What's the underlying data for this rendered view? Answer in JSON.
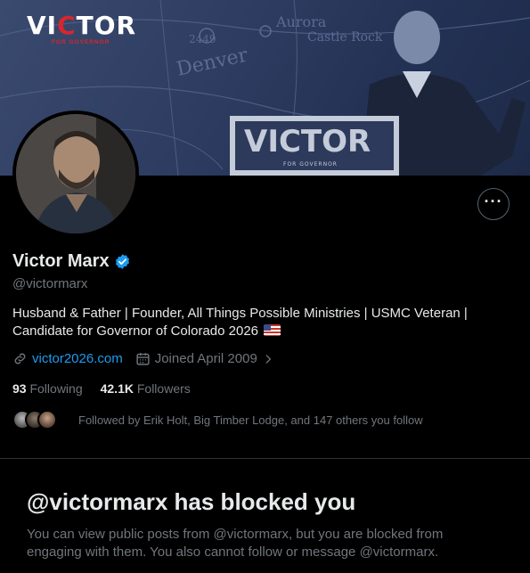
{
  "banner": {
    "brand_title_pre": "VI",
    "brand_title_o": "C",
    "brand_title_post": "TOR",
    "brand_subtitle": "FOR GOVERNOR",
    "map_labels": [
      "Aurora",
      "Castle Rock",
      "Denver",
      "2449"
    ],
    "podium_text": "VICTOR",
    "podium_sub": "FOR GOVERNOR"
  },
  "profile": {
    "name": "Victor Marx",
    "handle": "@victormarx",
    "bio_line1": "Husband & Father | Founder, All Things Possible Ministries | USMC Veteran |",
    "bio_line2": "Candidate for Governor of Colorado 2026",
    "website": "victor2026.com",
    "joined": "Joined April 2009",
    "following_count": "93",
    "following_label": "Following",
    "followers_count": "42.1K",
    "followers_label": "Followers",
    "followed_by": "Followed by Erik Holt, Big Timber Lodge, and 147 others you follow"
  },
  "icons": {
    "more": "more-options-icon",
    "verified": "verified-badge-icon",
    "link": "link-icon",
    "calendar": "calendar-icon",
    "chevron": "chevron-right-icon",
    "flag": "us-flag-icon"
  },
  "blocked": {
    "title": "@victormarx has blocked you",
    "line1": "You can view public posts from @victormarx, but you are blocked from",
    "line2": "engaging with them. You also cannot follow or message @victormarx."
  },
  "colors": {
    "accent": "#1d9bf0",
    "muted": "#71767b",
    "text": "#e7e9ea",
    "background": "#000000",
    "brand_red": "#d8262d"
  }
}
